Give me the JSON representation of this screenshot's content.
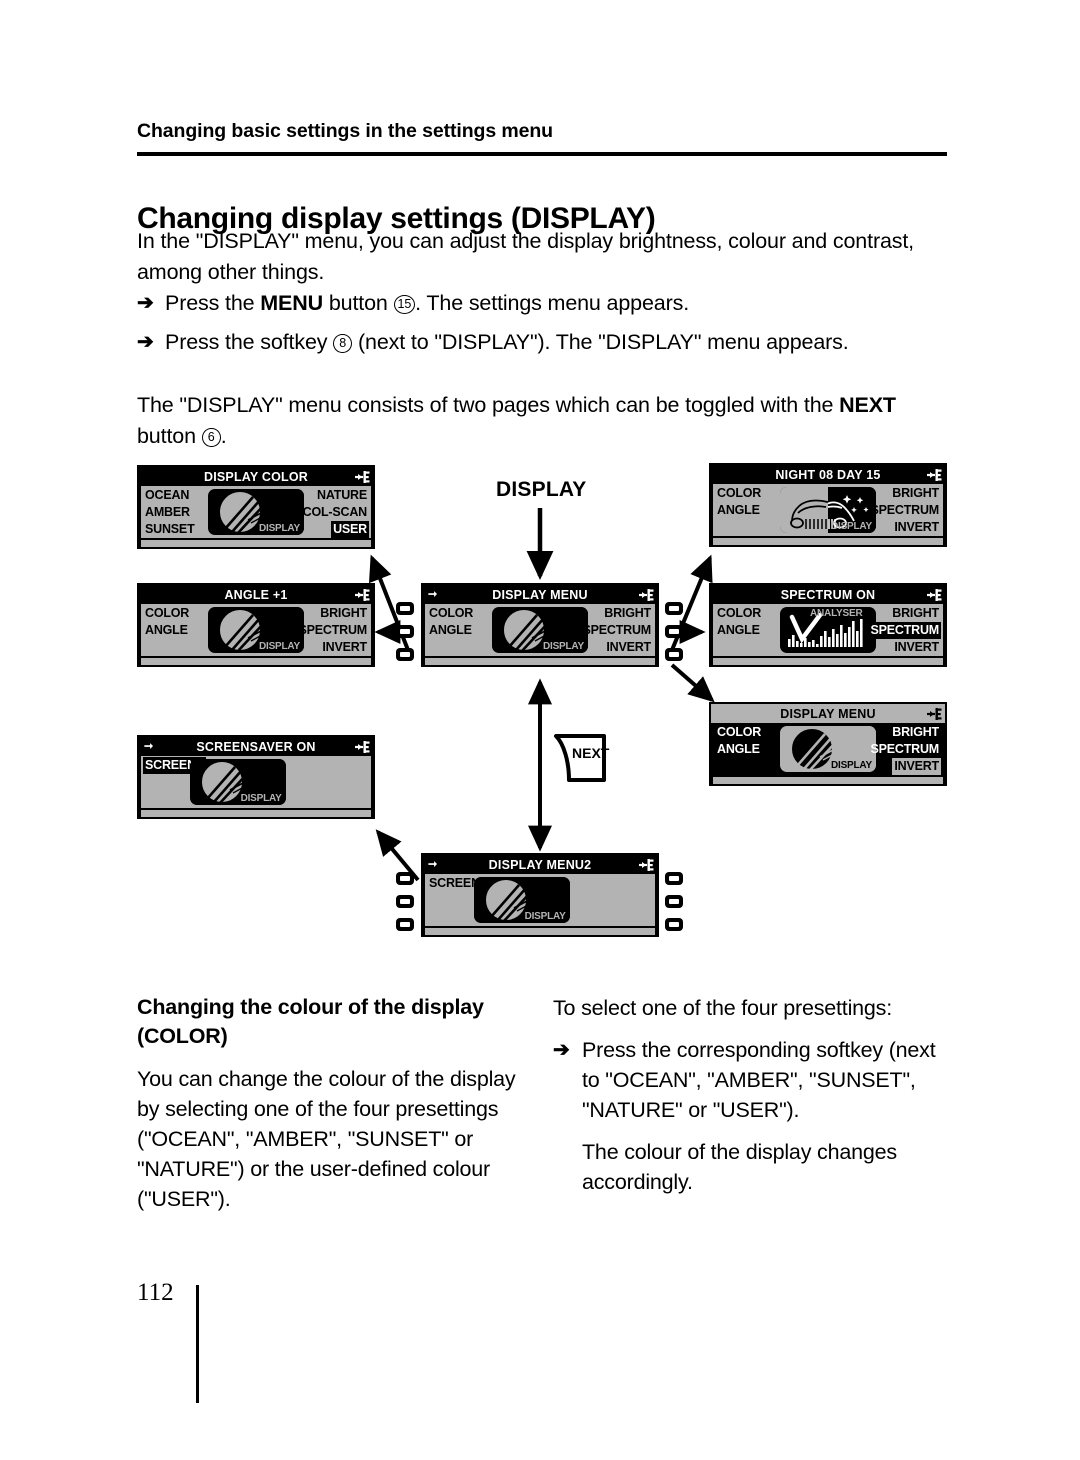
{
  "running_head": "Changing basic settings in the settings menu",
  "title": "Changing display settings (DISPLAY)",
  "intro": "In the \"DISPLAY\" menu, you can adjust the display brightness, colour and contrast, among other things.",
  "steps": [
    {
      "arrow": "➔",
      "pre": "Press the ",
      "bold": "MENU",
      "mid": " button ",
      "ref": "15",
      "post": ". The settings menu appears."
    },
    {
      "arrow": "➔",
      "pre": "Press the softkey ",
      "bold": "",
      "mid": "",
      "ref": "8",
      "post": " (next to \"DISPLAY\"). The \"DISPLAY\" menu appears."
    }
  ],
  "pages_note": {
    "pre": "The \"DISPLAY\" menu consists of two pages which can be toggled with the ",
    "bold": "NEXT",
    "mid": " button ",
    "ref": "6",
    "post": "."
  },
  "diagram": {
    "center_label": "DISPLAY",
    "next_key_label": "NEXT",
    "panels": {
      "display_color": {
        "title": "DISPLAY COLOR",
        "left": [
          "OCEAN",
          "AMBER",
          "SUNSET"
        ],
        "right": [
          "NATURE",
          "COL-SCAN",
          "USER"
        ],
        "highlight_right": "USER",
        "tile_word": "DISPLAY",
        "tile_art": "sphere",
        "inverted": false,
        "title_arrow": false
      },
      "angle": {
        "title": "ANGLE +1",
        "left": [
          "COLOR",
          "ANGLE"
        ],
        "right": [
          "BRIGHT",
          "SPECTRUM",
          "INVERT"
        ],
        "highlight_right": "",
        "tile_word": "DISPLAY",
        "tile_art": "sphere",
        "inverted": false,
        "title_arrow": false
      },
      "screensaver": {
        "title": "SCREENSAVER ON",
        "left": [
          "SCREENS"
        ],
        "right": [],
        "highlight_left": "SCREENS",
        "tile_word": "DISPLAY",
        "tile_art": "sphere",
        "inverted": false,
        "title_arrow": true
      },
      "display_menu": {
        "title": "DISPLAY MENU",
        "left": [
          "COLOR",
          "ANGLE"
        ],
        "right": [
          "BRIGHT",
          "SPECTRUM",
          "INVERT"
        ],
        "highlight_right": "",
        "tile_word": "DISPLAY",
        "tile_art": "sphere",
        "inverted": false,
        "title_arrow": true
      },
      "display_menu2": {
        "title": "DISPLAY MENU2",
        "left": [
          "SCREENS"
        ],
        "right": [],
        "highlight_left": "",
        "tile_word": "DISPLAY",
        "tile_art": "sphere",
        "inverted": false,
        "title_arrow": true
      },
      "night_day": {
        "title": "NIGHT 08   DAY 15",
        "left": [
          "COLOR",
          "ANGLE"
        ],
        "right": [
          "BRIGHT",
          "SPECTRUM",
          "INVERT"
        ],
        "highlight_right": "",
        "tile_word": "DISPLAY",
        "tile_art": "car",
        "inverted": false,
        "title_arrow": false
      },
      "spectrum": {
        "title": "SPECTRUM ON",
        "left": [
          "COLOR",
          "ANGLE"
        ],
        "right": [
          "BRIGHT",
          "SPECTRUM",
          "INVERT"
        ],
        "highlight_right": "SPECTRUM",
        "tile_word": "ANALYSER",
        "tile_art": "analyser",
        "inverted": false,
        "title_arrow": false
      },
      "invert": {
        "title": "DISPLAY MENU",
        "left": [
          "COLOR",
          "ANGLE"
        ],
        "right": [
          "BRIGHT",
          "SPECTRUM",
          "INVERT"
        ],
        "highlight_right": "INVERT",
        "tile_word": "DISPLAY",
        "tile_art": "sphere",
        "inverted": true,
        "title_arrow": false
      }
    }
  },
  "section": {
    "heading": "Changing the colour of the display (COLOR)",
    "left_body": "You can change the colour of the display by selecting one of the four presettings (\"OCEAN\", \"AMBER\", \"SUNSET\" or \"NATURE\") or the user-defined colour (\"USER\").",
    "right_lead": "To select one of the four presettings:",
    "right_step_arrow": "➔",
    "right_step": "Press the corresponding softkey (next to \"OCEAN\", \"AMBER\", \"SUNSET\", \"NATURE\" or \"USER\").",
    "right_result": "The colour of the display changes accordingly."
  },
  "page_number": "112"
}
